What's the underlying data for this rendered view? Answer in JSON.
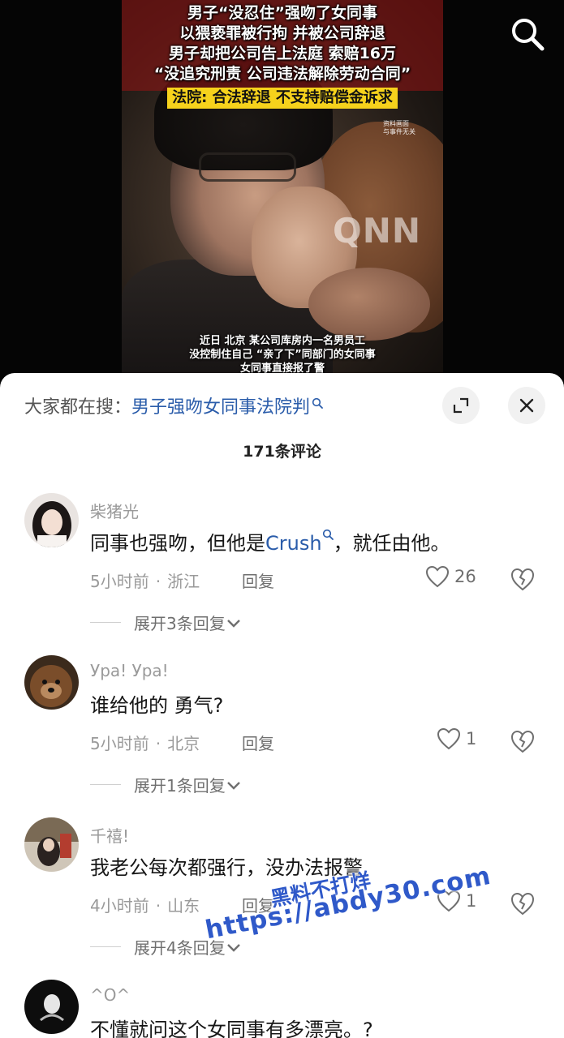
{
  "video": {
    "headline_lines": [
      "男子“没忍住”强吻了女同事",
      "以猥亵罪被行拘 并被公司辞退",
      "男子却把公司告上法庭 索赔16万",
      "“没追究刑责 公司违法解除劳动合同”"
    ],
    "verdict": "法院: 合法辞退 不支持赔偿金诉求",
    "source_note": [
      "资料画面",
      "与事件无关"
    ],
    "logo": "QNN",
    "subtitle_lines": [
      "近日 北京 某公司库房内一名男员工",
      "没控制住自己 “亲了下”同部门的女同事",
      "女同事直接报了警"
    ]
  },
  "sheet": {
    "search_prefix": "大家都在搜：",
    "search_query": "男子强吻女同事法院判",
    "count_title": "171条评论"
  },
  "comments": [
    {
      "user": "柴猪光",
      "text_before": "同事也强吻，但他是",
      "text_link": "Crush",
      "text_after": "，就任由他。",
      "time": "5小时前",
      "location": "浙江",
      "reply": "回复",
      "likes": "26",
      "expand": "展开3条回复"
    },
    {
      "user": "Ура!  Ура!",
      "text": "谁给他的  勇气?",
      "time": "5小时前",
      "location": "北京",
      "reply": "回复",
      "likes": "1",
      "expand": "展开1条回复"
    },
    {
      "user": "千禧!",
      "text": "我老公每次都强行，没办法报警",
      "time": "4小时前",
      "location": "山东",
      "reply": "回复",
      "likes": "1",
      "expand": "展开4条回复"
    },
    {
      "user": "^O^",
      "text": "不懂就问这个女同事有多漂亮。?"
    }
  ],
  "watermark": {
    "line1": "黑料不打烊",
    "line2": "https://abdy30.com"
  },
  "colors": {
    "link": "#2a5caa",
    "watermark": "#2f59c9",
    "verdict_bg": "#f6d21c"
  }
}
